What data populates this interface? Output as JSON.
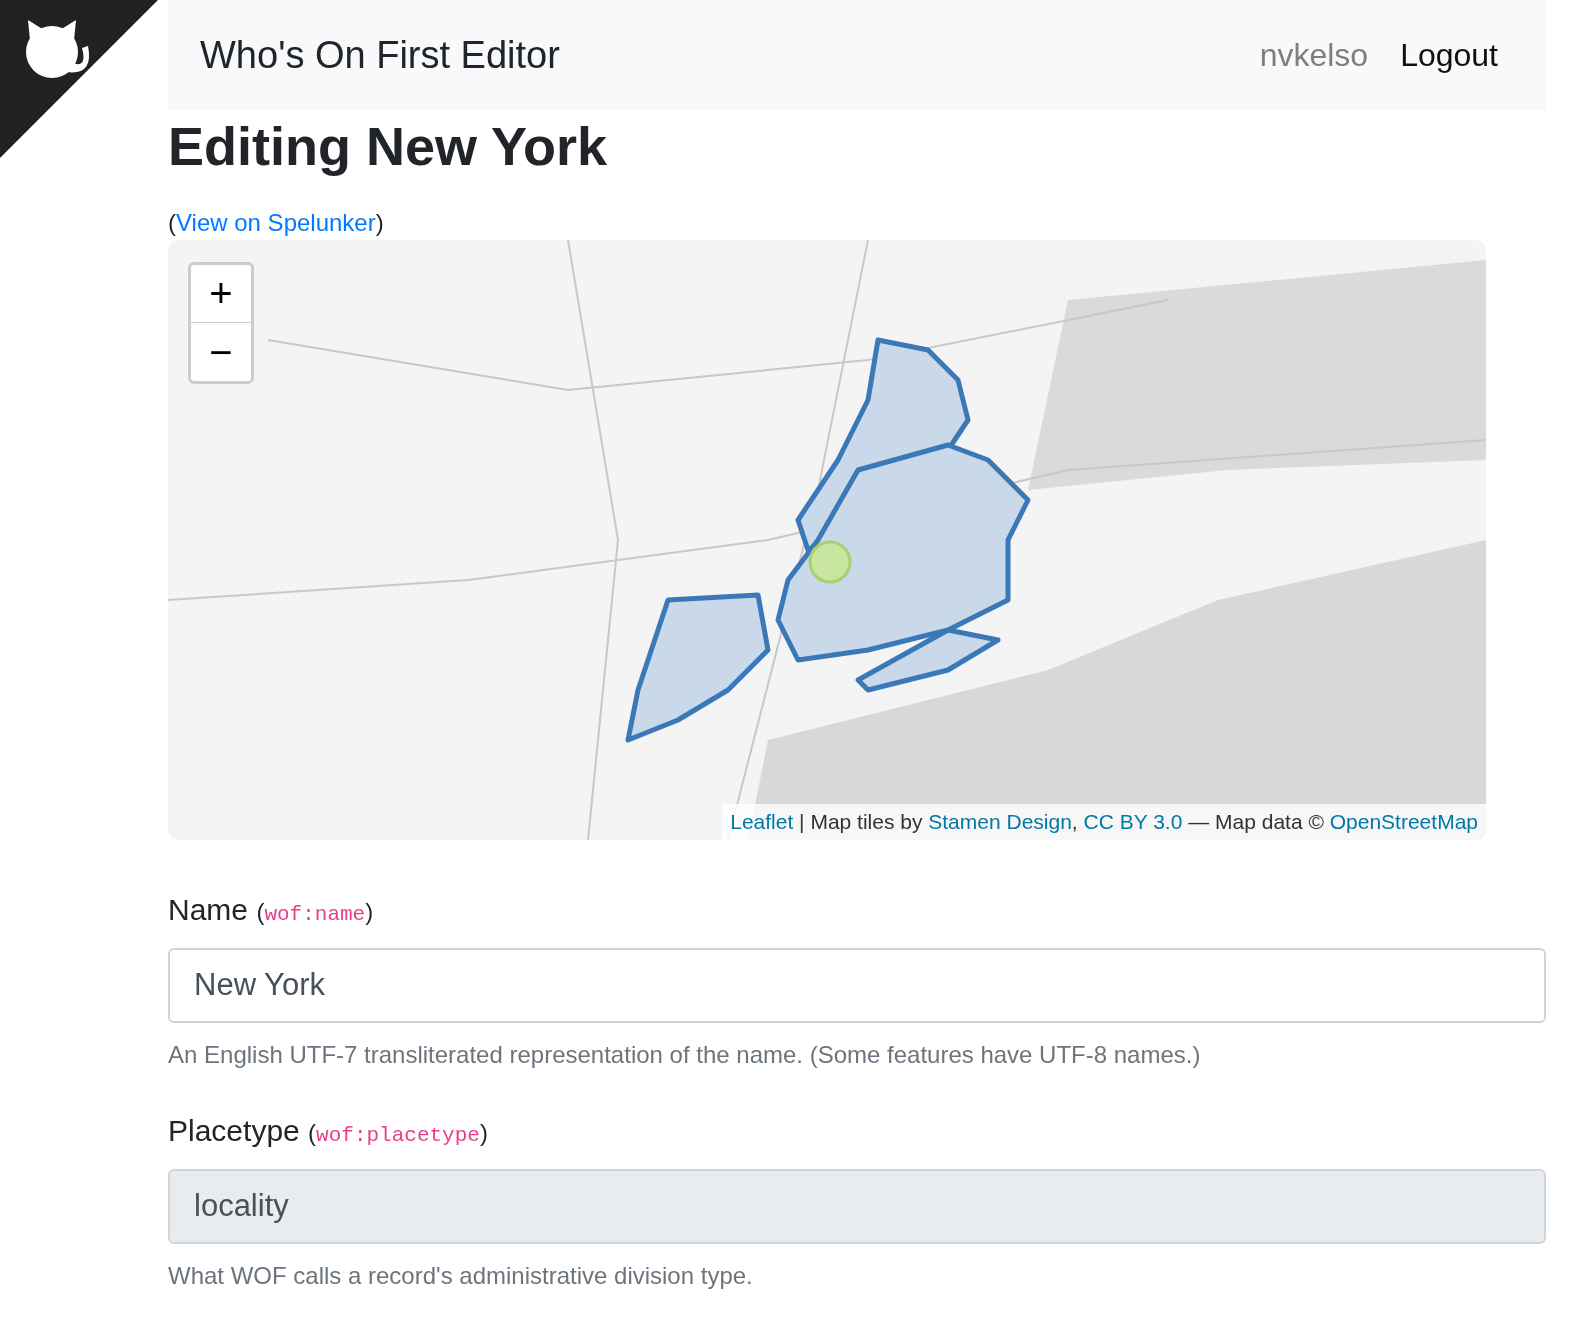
{
  "header": {
    "title": "Who's On First Editor",
    "user": "nvkelso",
    "logout": "Logout"
  },
  "page": {
    "heading": "Editing New York",
    "link_open": "(",
    "link": "View on Spelunker",
    "link_close": ")"
  },
  "map": {
    "zoom_in": "+",
    "zoom_out": "−",
    "attribution": [
      {
        "kind": "link",
        "text": "Leaflet"
      },
      {
        "kind": "text",
        "text": " | Map tiles by "
      },
      {
        "kind": "link",
        "text": "Stamen Design"
      },
      {
        "kind": "text",
        "text": ", "
      },
      {
        "kind": "link",
        "text": "CC BY 3.0"
      },
      {
        "kind": "text",
        "text": " — Map data © "
      },
      {
        "kind": "link",
        "text": "OpenStreetMap"
      }
    ]
  },
  "fields": [
    {
      "label": "Name",
      "key_open": "(",
      "key": "wof:name",
      "key_close": ")",
      "value": "New York",
      "disabled": false,
      "help": "An English UTF-7 transliterated representation of the name. (Some features have UTF-8 names.)"
    },
    {
      "label": "Placetype",
      "key_open": "(",
      "key": "wof:placetype",
      "key_close": ")",
      "value": "locality",
      "disabled": true,
      "help": "What WOF calls a record's administrative division type."
    }
  ]
}
